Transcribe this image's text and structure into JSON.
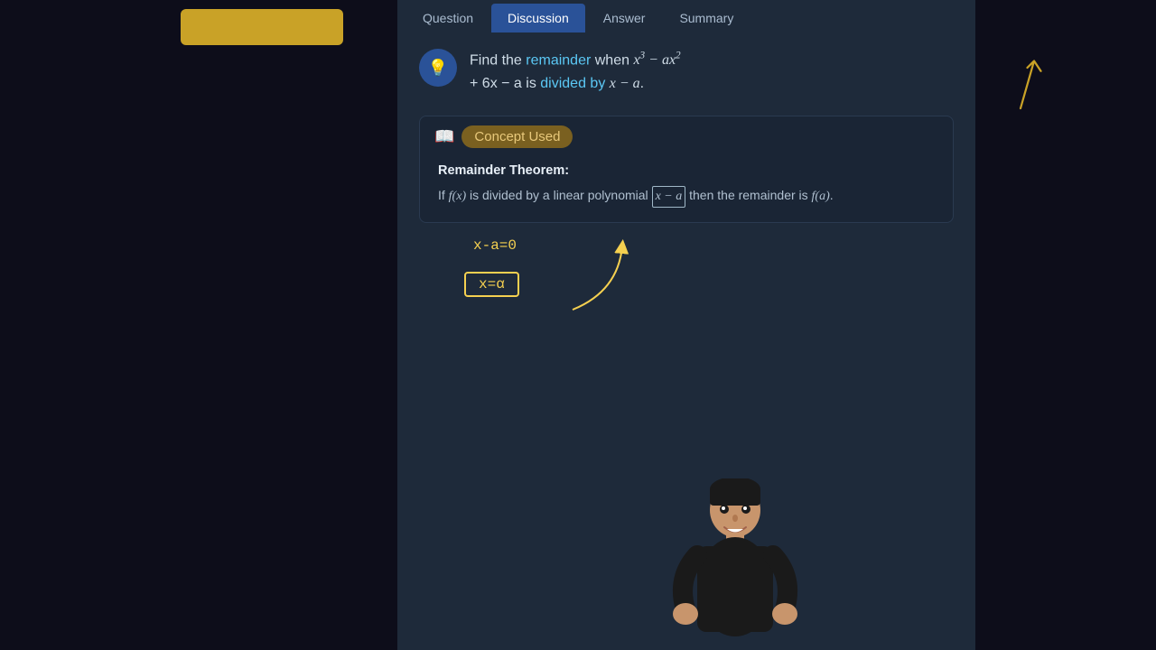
{
  "tabs": [
    {
      "id": "question",
      "label": "Question",
      "active": false
    },
    {
      "id": "discussion",
      "label": "Discussion",
      "active": true
    },
    {
      "id": "answer",
      "label": "Answer",
      "active": false
    },
    {
      "id": "summary",
      "label": "Summary",
      "active": false
    }
  ],
  "question": {
    "prefix": "Find the",
    "highlight1": "remainder",
    "middle1": " when ",
    "equation": "x³ − ax²",
    "equation2": "+ 6x − a",
    "highlight2": "divided by",
    "suffix": " x − a.",
    "icon": "💡"
  },
  "concept": {
    "label": "Concept Used",
    "icon": "📖",
    "theorem_title": "Remainder Theorem:",
    "theorem_text": "is divided by a linear polynomial",
    "boxed_term": "x − a",
    "theorem_suffix": "then the remainder is",
    "theorem_end": "f(a)."
  },
  "annotation": {
    "line1": "x-a=0",
    "line2": "x=α"
  }
}
